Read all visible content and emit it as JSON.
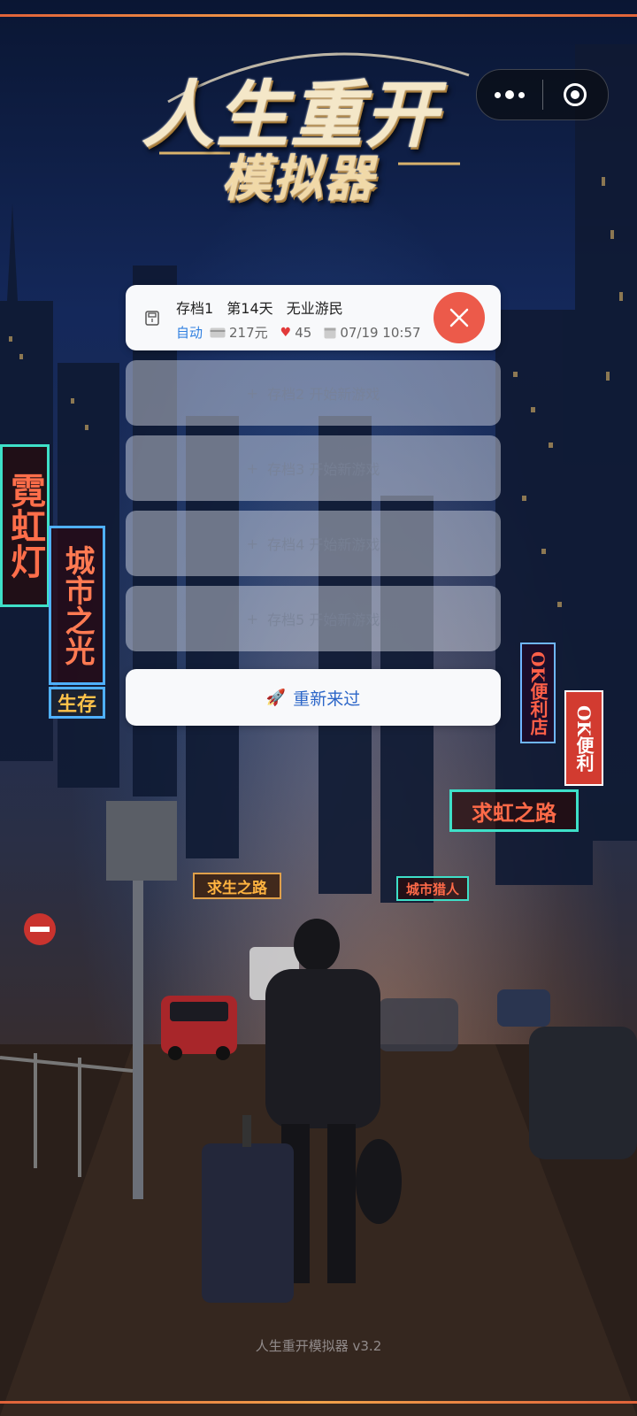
{
  "app": {
    "logo_line1": "人生重开",
    "logo_line2": "模拟器",
    "footer": "人生重开模拟器 v3.2"
  },
  "capsule": {
    "more_icon": "more-dots-icon",
    "close_icon": "target-circle-icon"
  },
  "saves": [
    {
      "slot_label": "存档1",
      "day": "第14天",
      "status": "无业游民",
      "mode": "自动",
      "money": "217元",
      "health": "45",
      "time": "07/19 10:57",
      "money_icon": "card-icon",
      "health_icon": "heart-icon",
      "time_icon": "calendar-icon",
      "delete_icon": "close-icon"
    },
    {
      "label": "存档2 开始新游戏",
      "plus": "+"
    },
    {
      "label": "存档3 开始新游戏",
      "plus": "+"
    },
    {
      "label": "存档4 开始新游戏",
      "plus": "+"
    },
    {
      "label": "存档5 开始新游戏",
      "plus": "+"
    }
  ],
  "restart": {
    "icon": "🚀",
    "label": "重新来过"
  },
  "signs": {
    "neon_vertical": "霓虹灯",
    "city_light": "城市之光",
    "survive": "生存",
    "ok_store": "OK便利店",
    "ok_convenience": "OK便利",
    "rainbow_road": "求虹之路",
    "survival_road": "求生之路",
    "city_hunter": "城市猎人"
  },
  "colors": {
    "accent": "#2f7fe0",
    "delete": "#ec5a4a",
    "restart_text": "#2c66c8"
  }
}
